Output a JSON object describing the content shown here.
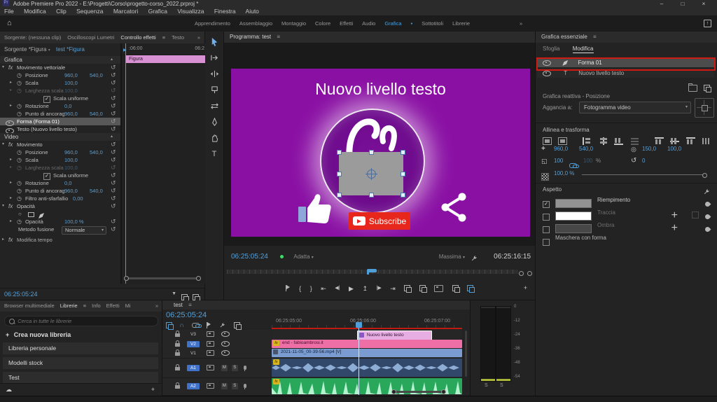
{
  "colors": {
    "accent_blue": "#2d8ceb",
    "timecode_blue": "#56a0d8",
    "annotation_red": "#d01910",
    "clip_pink": "#ee6fa6",
    "clip_graphic": "#e7aee3",
    "clip_video_blue": "#7b9cd0",
    "clip_audio_navy": "#31486a",
    "clip_audio_green": "#29a85c",
    "video_purple": "#8a10a4",
    "subscribe_red": "#e7271c"
  },
  "icons": {
    "menu": "≡",
    "overflow": "»",
    "home": "⌂",
    "min": "–",
    "max": "□",
    "close": "×",
    "caret_down": "▾",
    "caret_right": "▸",
    "caret_up": "▴",
    "dropdown": "▾",
    "stopwatch": "◷",
    "reset": "↺",
    "fx": "fx",
    "check": "✓",
    "play": "▶",
    "step_back": "◀|",
    "step_forward": "|▶",
    "go_in": "⇤",
    "go_out": "⇥",
    "mark_in": "{",
    "mark_out": "}",
    "export_up": "↥",
    "plus": "+",
    "funnel": "▼",
    "cloud": "☁",
    "magnet": "∩",
    "anchor": "◎",
    "scale": "◱",
    "rotate": "↺",
    "move": "+",
    "ellipse": "○",
    "type": "T",
    "workspace_dot": "▪",
    "arrow_up": "↑"
  },
  "titlebar": {
    "title": "Adobe Premiere Pro 2022 - E:\\Progetti\\Corso\\progetto-corso_2022.prproj *",
    "logo": "Pr"
  },
  "menubar": {
    "items": [
      "File",
      "Modifica",
      "Clip",
      "Sequenza",
      "Marcatori",
      "Grafica",
      "Visualizza",
      "Finestra",
      "Aiuto"
    ]
  },
  "workspaces": {
    "items": [
      "Apprendimento",
      "Assemblaggio",
      "Montaggio",
      "Colore",
      "Effetti",
      "Audio",
      "Grafica",
      "Sottotitoli",
      "Librerie"
    ]
  },
  "effect_controls": {
    "tab_source": "Sorgente: (nessuna clip)",
    "tab_scopes": "Oscilloscopi Lumetri",
    "tab_effects": "Controllo effetti",
    "tab_text": "Testo",
    "clip_source": "Sorgente *Figura",
    "clip_sequence": "test *Figura",
    "lane_tc_left": ":06:00",
    "lane_tc_right": "06:2",
    "lane_clip": "Figura",
    "section_graphics": "Grafica",
    "section_video": "Video",
    "g_motion": "Movimento vettoriale",
    "v_motion": "Movimento",
    "pos_label": "Posizione",
    "pos_x": "960,0",
    "pos_y": "540,0",
    "scale_label": "Scala",
    "scale_v": "100,0",
    "scalew_label": "Larghezza scala",
    "scalew_v": "100,0",
    "uniform_label": "Scala uniforme",
    "rot_label": "Rotazione",
    "rot_v": "0,0",
    "anchor_label": "Punto di ancoragg.",
    "anchor_x": "960,0",
    "anchor_y": "540,0",
    "layer_shape": "Forma (Forma 01)",
    "layer_text": "Testo (Nuovo livello testo)",
    "flicker_label": "Filtro anti-sfarfallio",
    "flicker_v": "0,00",
    "opacity_group": "Opacità",
    "opacity_label": "Opacità",
    "opacity_v": "100,0 %",
    "blend_label": "Metodo fusione",
    "blend_value": "Normale",
    "remap_label": "Modifica tempo",
    "footer_tc": "06:25:05:24"
  },
  "program": {
    "title": "Programma: test",
    "tc": "06:25:05:24",
    "fit": "Adatta",
    "quality": "Massima",
    "tc_out": "06:25:16:15",
    "video_title": "Nuovo livello testo",
    "subscribe": "Subscribe"
  },
  "eg": {
    "title": "Grafica essenziale",
    "tab_browse": "Sfoglia",
    "tab_edit": "Modifica",
    "layer1": "Forma 01",
    "layer2": "Nuovo livello testo",
    "responsive": "Grafica reattiva - Posizione",
    "pin_label": "Aggancia a:",
    "pin_value": "Fotogramma video",
    "align_title": "Allinea e trasforma",
    "pos_x": "960,0",
    "pos_y": "540,0",
    "anchor_x": "150,0",
    "anchor_y": "100,0",
    "scale_a": "100",
    "scale_b": "100",
    "pct": "%",
    "rot": "0",
    "opacity": "100,0 %",
    "aspect_title": "Aspetto",
    "fill": "Riempimento",
    "stroke": "Traccia",
    "shadow": "Ombra",
    "mask": "Maschera con forma"
  },
  "libraries": {
    "tab_browser": "Browser multimediale",
    "tab_libraries": "Librerie",
    "tab_info": "Info",
    "tab_effects": "Effetti",
    "tab_more": "Mi",
    "search_placeholder": "Cerca in tutte le librerie",
    "create": "Crea nuova libreria",
    "items": [
      "Libreria personale",
      "Modelli stock",
      "Test"
    ]
  },
  "timeline": {
    "tab": "test",
    "tc": "06:25:05:24",
    "ruler": [
      "06:25:05:00",
      "06:25:06:00",
      "06:25:07:00"
    ],
    "v3": "V3",
    "v2": "V2",
    "v1": "V1",
    "a1": "A1",
    "a2": "A2",
    "mute": "M",
    "solo": "S",
    "clip_v3": "Nuovo livello testo",
    "clip_v2": "end - fabioambrosi.it",
    "clip_v1": "2021-11-05_00-39-56.mp4 [V]",
    "fx": "fx"
  },
  "meters": {
    "scale": [
      "0",
      "-12",
      "-24",
      "-36",
      "-48",
      "-54"
    ],
    "solo_l": "S",
    "solo_r": "S"
  }
}
